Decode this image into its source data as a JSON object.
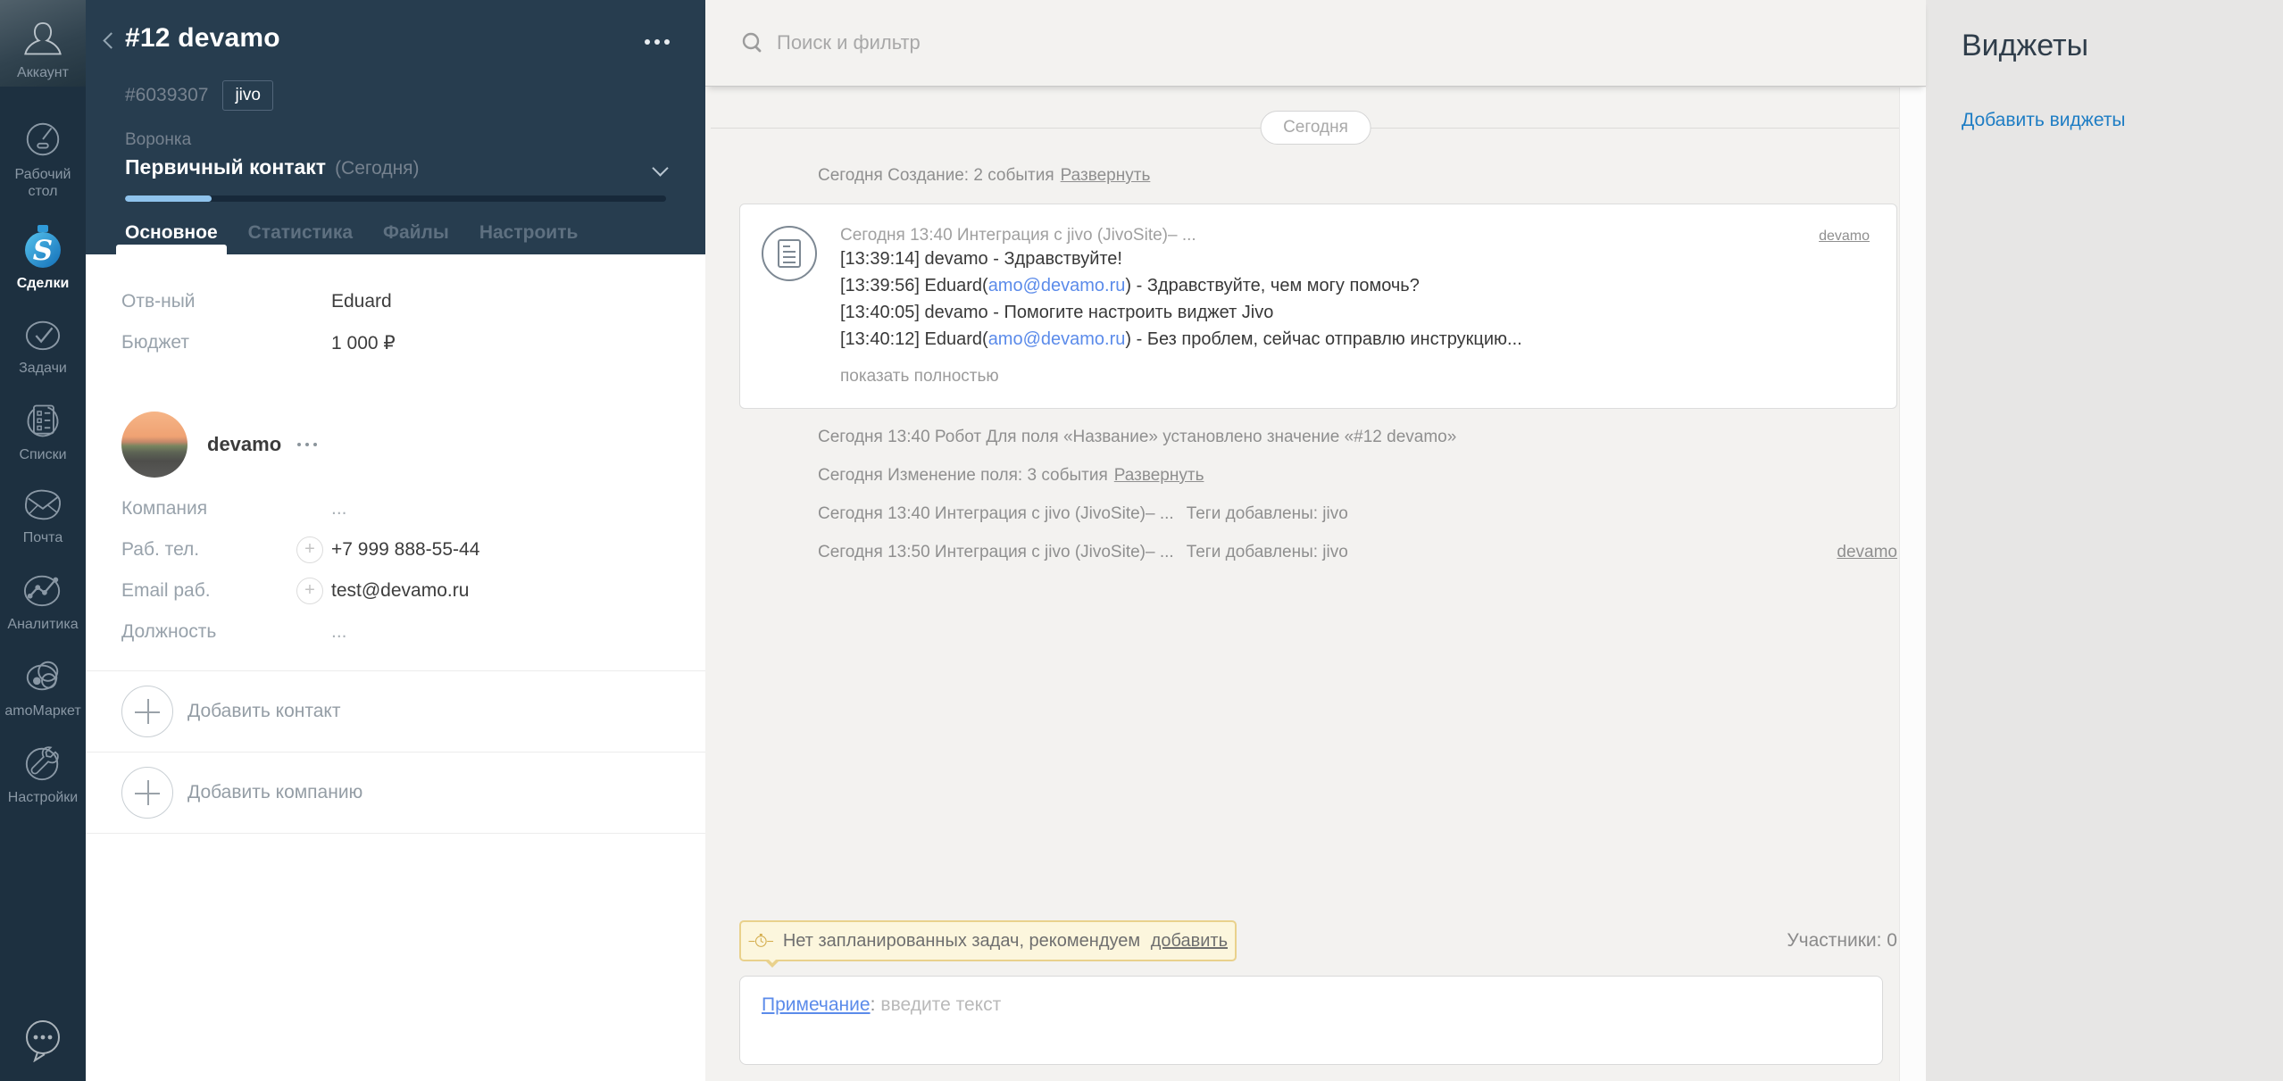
{
  "colors": {
    "sidebar_bg": "#1d3040",
    "header_bg": "#273d4f",
    "timeline_bg": "#f3f2f0",
    "widgets_bg": "#e7e6e5",
    "progress_fill": "#8fc3ec",
    "link_blue": "#5b8bea",
    "widgets_link": "#1e7dc4",
    "banner_bg": "#fcf6dd",
    "banner_border": "#e9d18c",
    "deals_icon_blue": "#2496d8",
    "text_dark": "#3d3d3d",
    "text_gray": "#8f8f8f"
  },
  "sidebar": {
    "account_label": "Аккаунт",
    "items": [
      {
        "id": "desktop",
        "label": "Рабочий стол"
      },
      {
        "id": "deals",
        "label": "Сделки",
        "active": true
      },
      {
        "id": "tasks",
        "label": "Задачи"
      },
      {
        "id": "lists",
        "label": "Списки"
      },
      {
        "id": "mail",
        "label": "Почта"
      },
      {
        "id": "analytics",
        "label": "Аналитика"
      },
      {
        "id": "market",
        "label": "amoМаркет"
      },
      {
        "id": "settings",
        "label": "Настройки"
      }
    ]
  },
  "deal": {
    "title": "#12 devamo",
    "id": "#6039307",
    "tag": "jivo",
    "funnel_label": "Воронка",
    "stage": "Первичный контакт",
    "stage_note": "(Сегодня)",
    "tabs": {
      "main": "Основное",
      "stats": "Статистика",
      "files": "Файлы",
      "setup": "Настроить"
    },
    "fields": {
      "responsible_label": "Отв-ный",
      "responsible": "Eduard",
      "budget_label": "Бюджет",
      "budget": "1 000 ₽"
    },
    "contact": {
      "name": "devamo",
      "company_label": "Компания",
      "company": "...",
      "phone_label": "Раб. тел.",
      "phone": "+7 999 888-55-44",
      "email_label": "Email раб.",
      "email": "test@devamo.ru",
      "position_label": "Должность",
      "position": "..."
    },
    "add_contact": "Добавить контакт",
    "add_company": "Добавить компанию"
  },
  "search": {
    "placeholder": "Поиск и фильтр"
  },
  "timeline": {
    "date_badge": "Сегодня",
    "creation": {
      "text": "Сегодня Создание: 2 события",
      "link": "Развернуть"
    },
    "message": {
      "meta": "Сегодня 13:40 Интеграция с jivo (JivoSite)– ...",
      "contact_link": "devamo",
      "lines": [
        {
          "pre": "[13:39:14] devamo - Здравствуйте!"
        },
        {
          "pre": "[13:39:56] Eduard(",
          "email": "amo@devamo.ru",
          "post": ") - Здравствуйте, чем могу помочь?"
        },
        {
          "pre": "[13:40:05] devamo - Помогите настроить виджет Jivo"
        },
        {
          "pre": "[13:40:12] Eduard(",
          "email": "amo@devamo.ru",
          "post": ") - Без проблем, сейчас отправлю инструкцию..."
        }
      ],
      "expand": "показать полностью"
    },
    "robot": {
      "text": "Сегодня 13:40 Робот Для поля «Название» установлено значение «#12 devamo»"
    },
    "field_change": {
      "text": "Сегодня Изменение поля: 3 события",
      "link": "Развернуть"
    },
    "tags1": {
      "text": "Сегодня 13:40 Интеграция с jivo (JivoSite)– ...",
      "tags": "Теги добавлены: jivo"
    },
    "tags2": {
      "text": "Сегодня 13:50 Интеграция с jivo (JivoSite)– ...",
      "tags": "Теги добавлены: jivo",
      "contact_link": "devamo"
    }
  },
  "bottom": {
    "task_banner": {
      "text": "Нет запланированных задач, рекомендуем",
      "link": "добавить"
    },
    "participants": "Участники: 0",
    "note": {
      "label": "Примечание",
      "separator": ":",
      "placeholder": "введите текст"
    }
  },
  "widgets": {
    "title": "Виджеты",
    "add_link": "Добавить виджеты"
  }
}
